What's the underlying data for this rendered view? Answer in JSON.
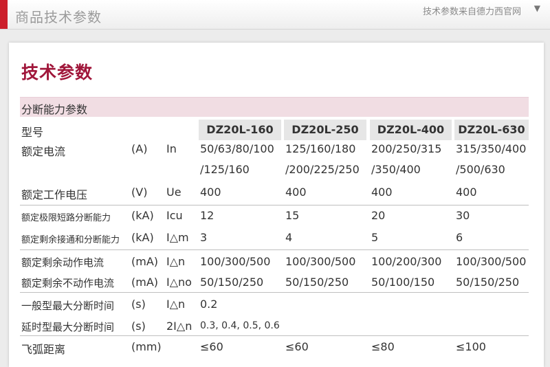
{
  "top_bar": {
    "title": "商品技术参数",
    "source_note": "技术参数来自德力西官网",
    "dropdown_glyph": "▼"
  },
  "panel": {
    "heading": "技术参数",
    "section_title": "分断能力参数"
  },
  "table": {
    "model_label": "型号",
    "models": [
      "DZ20L-160",
      "DZ20L-250",
      "DZ20L-400",
      "DZ20L-630"
    ],
    "rows": {
      "rated_current": {
        "label": "额定电流",
        "unit": "(A)",
        "symbol": "In",
        "values_line1": [
          "50/63/80/100",
          "125/160/180",
          "200/250/315",
          "315/350/400"
        ],
        "values_line2": [
          "/125/160",
          "/200/225/250",
          "/350/400",
          "/500/630"
        ]
      },
      "rated_voltage": {
        "label": "额定工作电压",
        "unit": "(V)",
        "symbol": "Ue",
        "values": [
          "400",
          "400",
          "400",
          "400"
        ]
      },
      "ultimate_breaking": {
        "label": "额定极限短路分断能力",
        "unit": "(kA)",
        "symbol": "Icu",
        "values": [
          "12",
          "15",
          "20",
          "30"
        ]
      },
      "residual_making_breaking": {
        "label": "额定剩余接通和分断能力",
        "unit": "(kA)",
        "symbol": "I△m",
        "values": [
          "3",
          "4",
          "5",
          "6"
        ]
      },
      "residual_operating_current": {
        "label": "额定剩余动作电流",
        "unit": "(mA)",
        "symbol": "I△n",
        "values": [
          "100/300/500",
          "100/300/500",
          "100/200/300",
          "100/300/500"
        ]
      },
      "residual_non_operating_current": {
        "label": "额定剩余不动作电流",
        "unit": "(mA)",
        "symbol": "I△no",
        "values": [
          "50/150/250",
          "50/150/250",
          "50/100/150",
          "50/150/250"
        ]
      },
      "general_max_break_time": {
        "label": "一般型最大分断时间",
        "unit": "(s)",
        "symbol": "I△n",
        "value": "0.2"
      },
      "delay_max_break_time": {
        "label": "延时型最大分断时间",
        "unit": "(s)",
        "symbol": "2I△n",
        "value": "0.3, 0.4, 0.5, 0.6"
      },
      "arc_distance": {
        "label": "飞弧距离",
        "unit": "(mm)",
        "values": [
          "≤60",
          "≤60",
          "≤80",
          "≤100"
        ]
      }
    }
  }
}
